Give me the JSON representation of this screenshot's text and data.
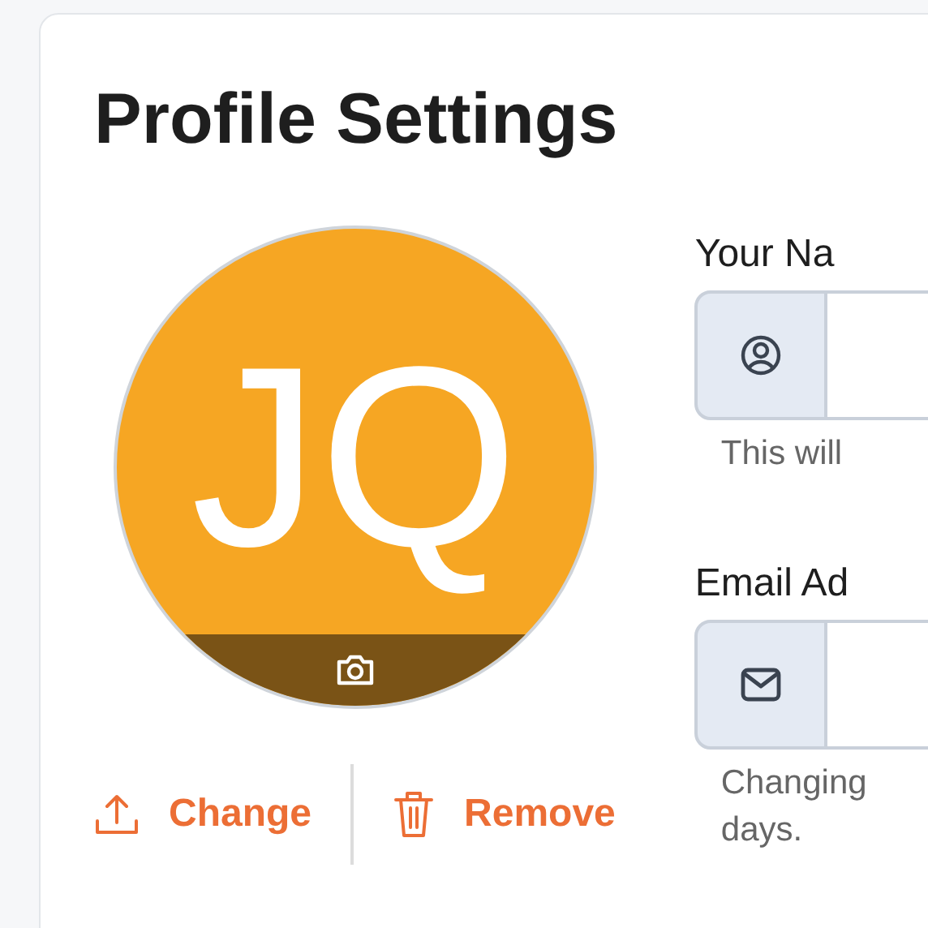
{
  "page": {
    "title": "Profile Settings"
  },
  "avatar": {
    "initials": "JQ"
  },
  "avatar_actions": [
    {
      "label": "Change",
      "kind": "upload"
    },
    {
      "label": "Remove",
      "kind": "delete"
    }
  ],
  "fields": [
    {
      "label": "Your Na",
      "kind": "name",
      "help": [
        "This will"
      ]
    },
    {
      "label": "Email Ad",
      "kind": "email",
      "help": [
        "Changing",
        "days."
      ]
    }
  ]
}
